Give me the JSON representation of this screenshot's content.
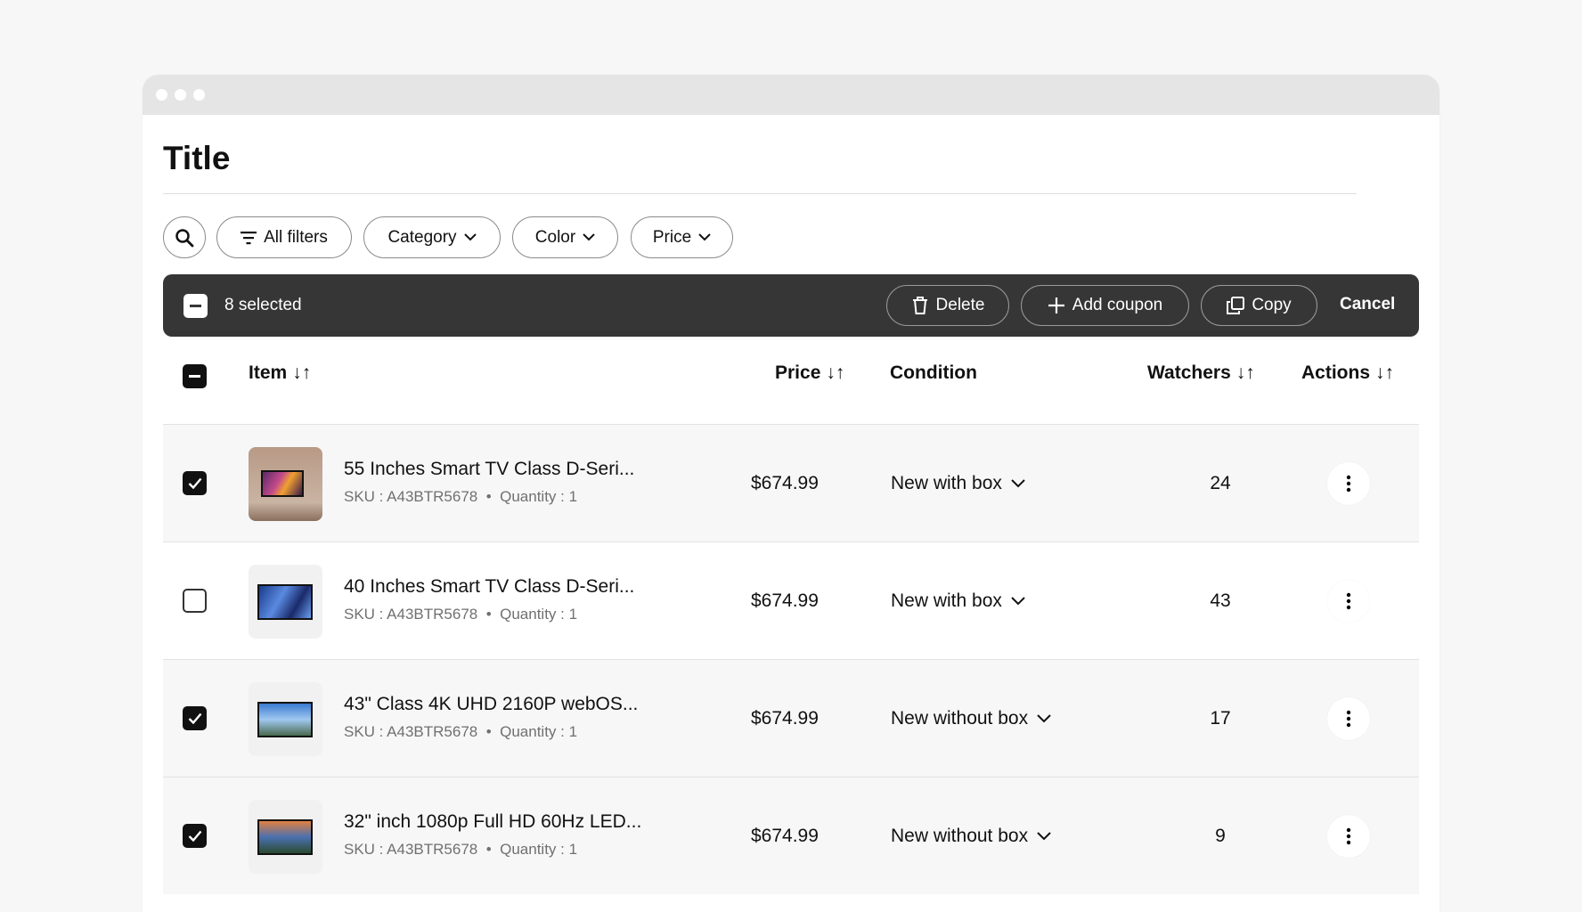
{
  "page": {
    "title": "Title"
  },
  "filters": {
    "all": "All filters",
    "category": "Category",
    "color": "Color",
    "price": "Price"
  },
  "selection": {
    "count_label": "8 selected",
    "delete": "Delete",
    "add_coupon": "Add coupon",
    "copy": "Copy",
    "cancel": "Cancel"
  },
  "columns": {
    "item": "Item",
    "price": "Price",
    "condition": "Condition",
    "watchers": "Watchers",
    "actions": "Actions"
  },
  "rows": [
    {
      "name": "55 Inches Smart TV Class D-Seri...",
      "sku": "SKU : A43BTR5678",
      "qty": "Quantity : 1",
      "price": "$674.99",
      "condition": "New with box",
      "watchers": "24",
      "checked": true
    },
    {
      "name": "40 Inches Smart TV Class D-Seri...",
      "sku": "SKU : A43BTR5678",
      "qty": "Quantity : 1",
      "price": "$674.99",
      "condition": "New with box",
      "watchers": "43",
      "checked": false
    },
    {
      "name": "43\" Class 4K UHD 2160P webOS...",
      "sku": "SKU : A43BTR5678",
      "qty": "Quantity : 1",
      "price": "$674.99",
      "condition": "New without box",
      "watchers": "17",
      "checked": true
    },
    {
      "name": "32\" inch 1080p Full HD 60Hz LED...",
      "sku": "SKU : A43BTR5678",
      "qty": "Quantity : 1",
      "price": "$674.99",
      "condition": "New without box",
      "watchers": "9",
      "checked": true
    }
  ]
}
